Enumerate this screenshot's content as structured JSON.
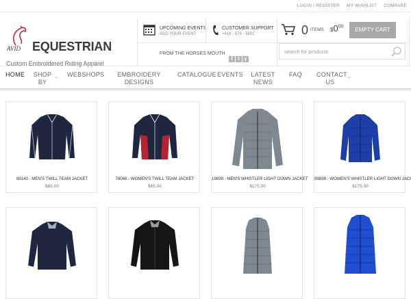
{
  "top_links": [
    "LOGIN / REGISTER",
    "MY WISHLIST",
    "COMPARE"
  ],
  "logo": {
    "mark_text": "AVID",
    "name": "EQUESTRIAN",
    "tagline": "Custom Embroidered Riding Apparel"
  },
  "header": {
    "events_title": "UPCOMING EVENTS",
    "events_sub": "ADD YOUR EVENT",
    "support_title": "CUSTOMER SUPPORT",
    "support_phone": "+416 - 576 - 5802",
    "from_horses": "FROM THE HORSES MOUTH",
    "social": [
      "f",
      "t",
      "y"
    ]
  },
  "cart": {
    "count": "0",
    "items_label": "ITEMS",
    "total_currency": "$",
    "total_whole": "0",
    "total_cents": "00",
    "empty_label": "EMPTY CART"
  },
  "search": {
    "placeholder": "search for products"
  },
  "nav": [
    "HOME",
    "SHOP BY",
    "WEBSHOPS",
    "EMBROIDERY DESIGNS",
    "CATALOGUE",
    "EVENTS",
    "LATEST NEWS",
    "FAQ",
    "CONTACT US"
  ],
  "products": [
    {
      "title": "88143 - MEN'S TWILL TEAM JACKET",
      "price": "$65.00"
    },
    {
      "title": "78066 - WOMEN'S TWILL TEAM JACKET",
      "price": "$65.00"
    },
    {
      "title": "19899 - MEN'S WHISTLER LIGHT DOWN JACKET",
      "price": "$175.00"
    },
    {
      "title": "99899 - WOMEN'S WHISTLER LIGHT DOWN JACKET",
      "price": "$175.00"
    },
    {
      "title": "",
      "price": ""
    },
    {
      "title": "",
      "price": ""
    },
    {
      "title": "",
      "price": ""
    },
    {
      "title": "",
      "price": ""
    }
  ],
  "colors": {
    "accent": "#a8a8a8",
    "navy": "#1f2740",
    "red": "#b52233",
    "gray_jacket": "#7e8890",
    "royal_blue": "#1f3fa8"
  }
}
